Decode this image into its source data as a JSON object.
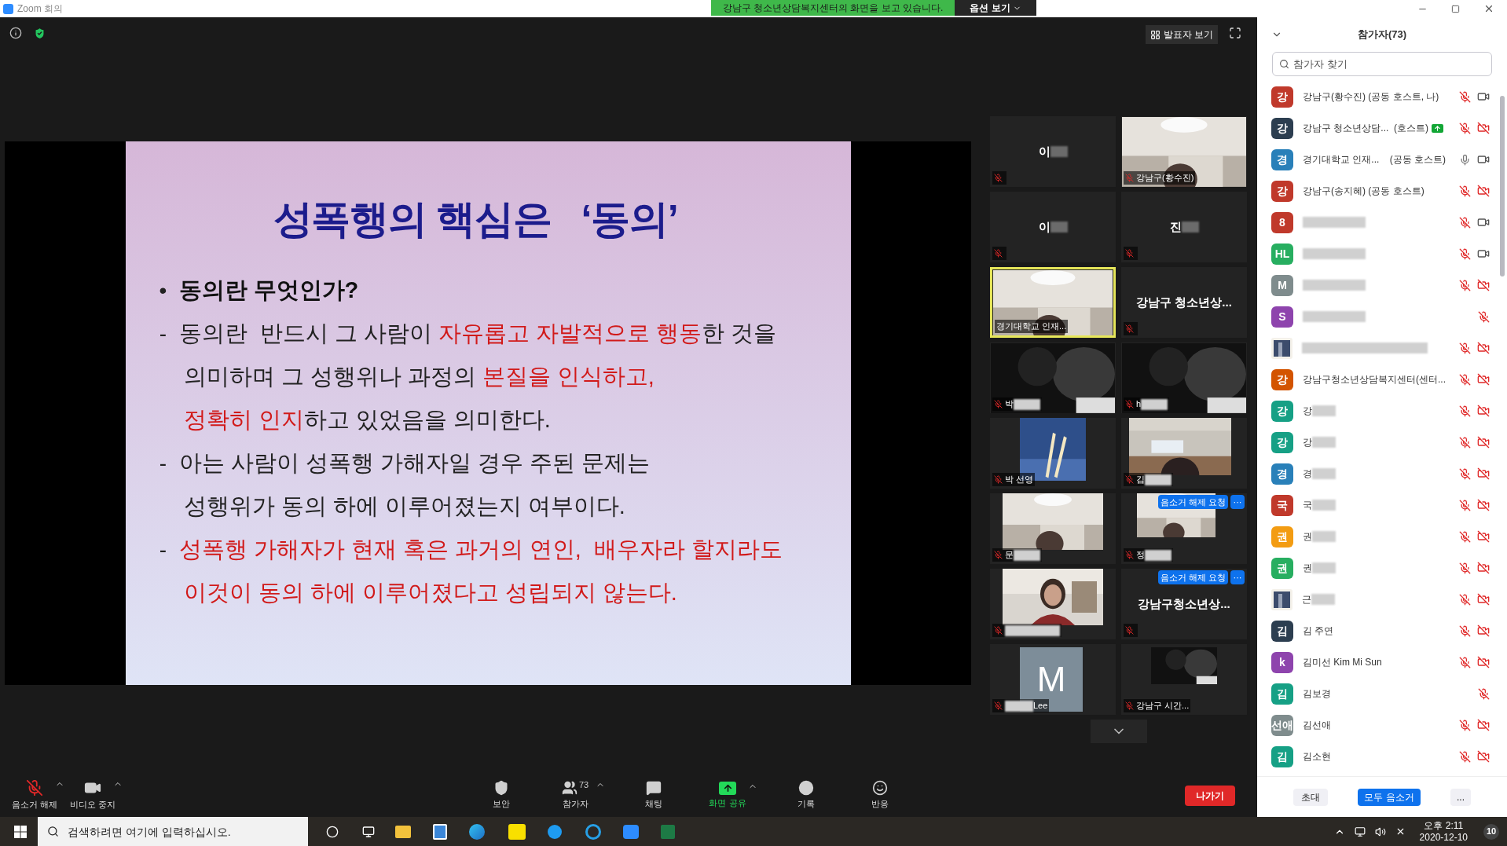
{
  "window": {
    "title": "Zoom 회의"
  },
  "share_banner": {
    "text": "강남구 청소년상담복지센터의 화면을 보고 있습니다.",
    "options": "옵션 보기"
  },
  "view_button": "발표자 보기",
  "slide": {
    "title": "성폭행의 핵심은   ‘동의’",
    "lines": [
      {
        "marker": "•",
        "bold": true,
        "segments": [
          {
            "text": "동의란 무엇인가?",
            "emphasis": false
          }
        ]
      },
      {
        "marker": "-",
        "bold": false,
        "segments": [
          {
            "text": "동의란  반드시 그 사람이 ",
            "emphasis": false
          },
          {
            "text": "자유롭고 자발적으로 행동",
            "emphasis": true
          },
          {
            "text": "한 것을",
            "emphasis": false
          }
        ]
      },
      {
        "bold": false,
        "segments": [
          {
            "text": "의미하며 그 성행위나 과정의 ",
            "emphasis": false
          },
          {
            "text": "본질을 인식하고,",
            "emphasis": true
          }
        ]
      },
      {
        "bold": false,
        "segments": [
          {
            "text": "정확히 인지",
            "emphasis": true
          },
          {
            "text": "하고 있었음을 의미한다.",
            "emphasis": false
          }
        ]
      },
      {
        "marker": "-",
        "bold": false,
        "segments": [
          {
            "text": "아는 사람이 성폭행 가해자일 경우 주된 문제는",
            "emphasis": false
          }
        ]
      },
      {
        "bold": false,
        "segments": [
          {
            "text": "성행위가 동의 하에 이루어졌는지 여부이다.",
            "emphasis": false
          }
        ]
      },
      {
        "marker": "-",
        "bold": false,
        "segments": [
          {
            "text": "성폭행 가해자가 현재 혹은 과거의 연인,  배우자라 할지라도",
            "emphasis": true
          }
        ]
      },
      {
        "bold": false,
        "segments": [
          {
            "text": "이것이 동의 하에 이루어졌다고 성립되지 않는다.",
            "emphasis": true
          }
        ]
      }
    ]
  },
  "gallery": [
    {
      "kind": "name",
      "name": "이",
      "blurred": true,
      "muted": true,
      "active_speaker": false
    },
    {
      "kind": "video",
      "label": "강남구(황수진)",
      "blurred": false,
      "muted": true,
      "active_speaker": false
    },
    {
      "kind": "name",
      "name": "이",
      "blurred": true,
      "muted": true,
      "active_speaker": false
    },
    {
      "kind": "name",
      "name": "진",
      "blurred": true,
      "muted": true,
      "active_speaker": false
    },
    {
      "kind": "video",
      "label": "경기대학교 인재...",
      "blurred": false,
      "muted": false,
      "active_speaker": true
    },
    {
      "kind": "name",
      "name": "강남구 청소년상...",
      "blurred": false,
      "muted": true,
      "active_speaker": false
    },
    {
      "kind": "video",
      "label": "박",
      "blurred": true,
      "muted": true,
      "active_speaker": false
    },
    {
      "kind": "video",
      "label": "h",
      "blurred": true,
      "muted": true,
      "active_speaker": false
    },
    {
      "kind": "video",
      "label": "박 선영",
      "blurred": false,
      "muted": true,
      "active_speaker": false
    },
    {
      "kind": "video",
      "label": "김",
      "blurred": true,
      "muted": true,
      "active_speaker": false
    },
    {
      "kind": "video",
      "label": "문",
      "blurred": true,
      "muted": true,
      "active_speaker": false
    },
    {
      "kind": "video",
      "label": "정",
      "blurred": true,
      "muted": true,
      "active_speaker": false,
      "request": "음소거 해제 요청",
      "more": "···"
    },
    {
      "kind": "video",
      "blurred": true,
      "muted": true,
      "active_speaker": false
    },
    {
      "kind": "name",
      "name": "강남구청소년상...",
      "blurred": false,
      "muted": true,
      "active_speaker": false,
      "request": "음소거 해제 요청",
      "more": "···"
    },
    {
      "kind": "avatar",
      "letter": "M",
      "label": "Lee",
      "blurred": true,
      "muted": true,
      "active_speaker": false
    },
    {
      "kind": "video",
      "label": "강남구 시간...",
      "blurred": false,
      "muted": true,
      "active_speaker": false
    }
  ],
  "toolbar": {
    "items": [
      {
        "kind": "mic",
        "label": "음소거 해제"
      },
      {
        "kind": "video",
        "label": "비디오 중지"
      },
      {
        "kind": "security",
        "label": "보안"
      },
      {
        "kind": "participants",
        "label": "참가자",
        "count": "73"
      },
      {
        "kind": "chat",
        "label": "채팅"
      },
      {
        "kind": "share",
        "label": "화면 공유"
      },
      {
        "kind": "record",
        "label": "기록"
      },
      {
        "kind": "reactions",
        "label": "반응"
      }
    ],
    "leave": "나가기"
  },
  "participants": {
    "title": "참가자(73)",
    "search": {
      "placeholder": "참가자 찾기"
    },
    "rows": [
      {
        "avatar": "강",
        "color": "#c0392b",
        "name": "강남구(황수진) (공동 호스트, 나)",
        "blurred": false,
        "mic_muted": true,
        "camera_on": true
      },
      {
        "avatar": "강",
        "color": "#2c3e50",
        "name": "강남구 청소년상담...  (호스트)",
        "blurred": false,
        "sharing": true,
        "mic_muted": true,
        "camera_on": false
      },
      {
        "avatar": "경",
        "color": "#2980b9",
        "name": "경기대학교 인재...    (공동 호스트)",
        "blurred": false,
        "mic_muted": false,
        "camera_on": true
      },
      {
        "avatar": "강",
        "color": "#c0392b",
        "name": "강남구(송지혜) (공동 호스트)",
        "blurred": false,
        "mic_muted": true,
        "camera_on": false
      },
      {
        "avatar": "8",
        "color": "#c0392b",
        "blurred": true,
        "mic_muted": true,
        "camera_on": true
      },
      {
        "avatar": "HL",
        "color": "#27ae60",
        "blurred": true,
        "mic_muted": true,
        "camera_on": true
      },
      {
        "avatar": "M",
        "color": "#7f8c8d",
        "blurred": true,
        "mic_muted": true,
        "camera_on": false
      },
      {
        "avatar": "S",
        "color": "#8e44ad",
        "blurred": true,
        "mic_muted": true
      },
      {
        "kind": "picture",
        "blurred": true,
        "mic_muted": true,
        "camera_on": false
      },
      {
        "avatar": "강",
        "color": "#d35400",
        "name": "강남구청소년상담복지센터(센터...",
        "blurred": false,
        "mic_muted": true,
        "camera_on": false
      },
      {
        "avatar": "강",
        "color": "#16a085",
        "name": "강",
        "blurred": true,
        "mic_muted": true,
        "camera_on": false
      },
      {
        "avatar": "강",
        "color": "#16a085",
        "name": "강",
        "blurred": true,
        "mic_muted": true,
        "camera_on": false
      },
      {
        "avatar": "경",
        "color": "#2980b9",
        "name": "경",
        "blurred": true,
        "mic_muted": true,
        "camera_on": false
      },
      {
        "avatar": "국",
        "color": "#c0392b",
        "name": "국",
        "blurred": true,
        "mic_muted": true,
        "camera_on": false
      },
      {
        "avatar": "권",
        "color": "#f39c12",
        "name": "권",
        "blurred": true,
        "mic_muted": true,
        "camera_on": false
      },
      {
        "avatar": "권",
        "color": "#27ae60",
        "name": "권",
        "blurred": true,
        "mic_muted": true,
        "camera_on": false
      },
      {
        "kind": "picture",
        "name": "근",
        "blurred": true,
        "mic_muted": true,
        "camera_on": false
      },
      {
        "avatar": "김",
        "color": "#2c3e50",
        "name": "김 주연",
        "blurred": false,
        "mic_muted": true,
        "camera_on": false
      },
      {
        "avatar": "k",
        "color": "#8e44ad",
        "name": "김미선 Kim Mi Sun",
        "blurred": false,
        "mic_muted": true,
        "camera_on": false
      },
      {
        "avatar": "김",
        "color": "#16a085",
        "name": "김보경",
        "blurred": false,
        "mic_muted": true
      },
      {
        "avatar": "선애",
        "color": "#7f8c8d",
        "name": "김선애",
        "blurred": false,
        "mic_muted": true,
        "camera_on": false
      },
      {
        "avatar": "김",
        "color": "#16a085",
        "name": "김소현",
        "blurred": false,
        "mic_muted": true,
        "camera_on": false
      }
    ],
    "invite": "초대",
    "mute_all": "모두 음소거",
    "more": "..."
  },
  "taskbar": {
    "search": {
      "placeholder": "검색하려면 여기에 입력하십시오."
    },
    "time": "오후 2:11",
    "date": "2020-12-10",
    "notifications": "10"
  }
}
